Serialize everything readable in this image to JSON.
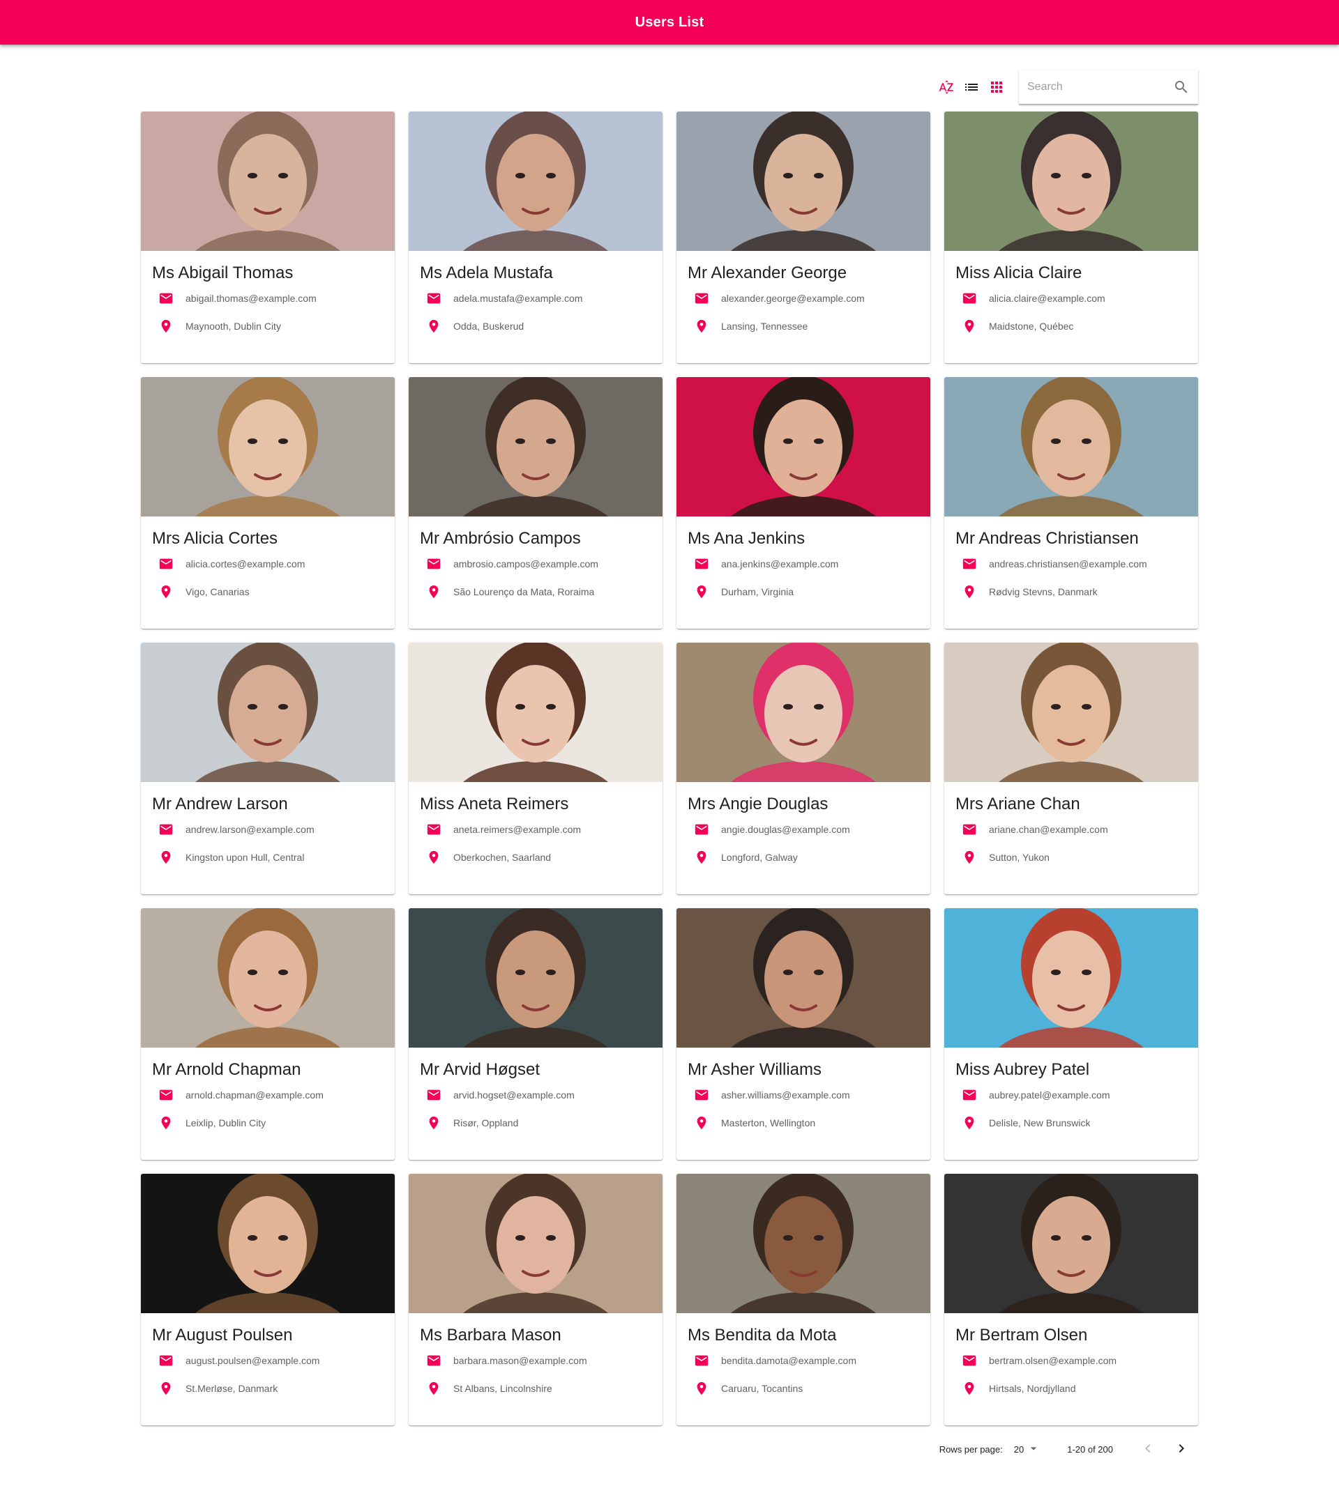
{
  "appbar": {
    "title": "Users List"
  },
  "toolbar": {
    "sort_icon": "sort-by-alpha-icon",
    "list_icon": "view-list-icon",
    "grid_icon": "view-module-icon",
    "search_placeholder": "Search",
    "search_value": "",
    "accent_color": "#f50057",
    "icon_color": "#212121"
  },
  "users": [
    {
      "name": "Ms Abigail Thomas",
      "email": "abigail.thomas@example.com",
      "location": "Maynooth, Dublin City"
    },
    {
      "name": "Ms Adela Mustafa",
      "email": "adela.mustafa@example.com",
      "location": "Odda, Buskerud"
    },
    {
      "name": "Mr Alexander George",
      "email": "alexander.george@example.com",
      "location": "Lansing, Tennessee"
    },
    {
      "name": "Miss Alicia Claire",
      "email": "alicia.claire@example.com",
      "location": "Maidstone, Québec"
    },
    {
      "name": "Mrs Alicia Cortes",
      "email": "alicia.cortes@example.com",
      "location": "Vigo, Canarias"
    },
    {
      "name": "Mr Ambrósio Campos",
      "email": "ambrosio.campos@example.com",
      "location": "São Lourenço da Mata, Roraima"
    },
    {
      "name": "Ms Ana Jenkins",
      "email": "ana.jenkins@example.com",
      "location": "Durham, Virginia"
    },
    {
      "name": "Mr Andreas Christiansen",
      "email": "andreas.christiansen@example.com",
      "location": "Rødvig Stevns, Danmark"
    },
    {
      "name": "Mr Andrew Larson",
      "email": "andrew.larson@example.com",
      "location": "Kingston upon Hull, Central"
    },
    {
      "name": "Miss Aneta Reimers",
      "email": "aneta.reimers@example.com",
      "location": "Oberkochen, Saarland"
    },
    {
      "name": "Mrs Angie Douglas",
      "email": "angie.douglas@example.com",
      "location": "Longford, Galway"
    },
    {
      "name": "Mrs Ariane Chan",
      "email": "ariane.chan@example.com",
      "location": "Sutton, Yukon"
    },
    {
      "name": "Mr Arnold Chapman",
      "email": "arnold.chapman@example.com",
      "location": "Leixlip, Dublin City"
    },
    {
      "name": "Mr Arvid Høgset",
      "email": "arvid.hogset@example.com",
      "location": "Risør, Oppland"
    },
    {
      "name": "Mr Asher Williams",
      "email": "asher.williams@example.com",
      "location": "Masterton, Wellington"
    },
    {
      "name": "Miss Aubrey Patel",
      "email": "aubrey.patel@example.com",
      "location": "Delisle, New Brunswick"
    },
    {
      "name": "Mr August Poulsen",
      "email": "august.poulsen@example.com",
      "location": "St.Merløse, Danmark"
    },
    {
      "name": "Ms Barbara Mason",
      "email": "barbara.mason@example.com",
      "location": "St Albans, Lincolnshire"
    },
    {
      "name": "Ms Bendita da Mota",
      "email": "bendita.damota@example.com",
      "location": "Caruaru, Tocantins"
    },
    {
      "name": "Mr Bertram Olsen",
      "email": "bertram.olsen@example.com",
      "location": "Hirtsals, Nordjylland"
    }
  ],
  "photo_palettes": [
    [
      "#c9a7a3",
      "#8a6a58",
      "#d9b49c"
    ],
    [
      "#b7c2d4",
      "#6a4e4a",
      "#d2a58a"
    ],
    [
      "#9aa3ad",
      "#3a2f2b",
      "#d9b39a"
    ],
    [
      "#7d8f6a",
      "#3a3030",
      "#e1b7a1"
    ],
    [
      "#a7a39c",
      "#a77a4a",
      "#e6c2a8"
    ],
    [
      "#6e6a63",
      "#3f2e25",
      "#d4a88e"
    ],
    [
      "#d01048",
      "#2a1d18",
      "#e0b196"
    ],
    [
      "#8aa9b6",
      "#8c6a3d",
      "#e3b99d"
    ],
    [
      "#c8cdd1",
      "#6a5040",
      "#d6ad94"
    ],
    [
      "#ece6e1",
      "#5a3424",
      "#ebc4b0"
    ],
    [
      "#9e8a6e",
      "#e0306a",
      "#e8c6b5"
    ],
    [
      "#d8ccc0",
      "#7a5638",
      "#e4bb9d"
    ],
    [
      "#b8aea2",
      "#9a6a3e",
      "#e3b79d"
    ],
    [
      "#3b4a4b",
      "#3a2c25",
      "#c9997c"
    ],
    [
      "#6a5544",
      "#2b2320",
      "#c99579"
    ],
    [
      "#4fb3d9",
      "#b8402e",
      "#e8c0a8"
    ],
    [
      "#141414",
      "#6b4a2d",
      "#e2b496"
    ],
    [
      "#b9a08a",
      "#4a3528",
      "#e0b49e"
    ],
    [
      "#8b8578",
      "#3a2a20",
      "#8a5a3e"
    ],
    [
      "#333333",
      "#2b211b",
      "#d8ab90"
    ]
  ],
  "pagination": {
    "rows_per_page_label": "Rows per page:",
    "rows_per_page_value": "20",
    "range_text": "1-20 of 200",
    "prev_icon": "chevron-left-icon",
    "next_icon": "chevron-right-icon"
  }
}
